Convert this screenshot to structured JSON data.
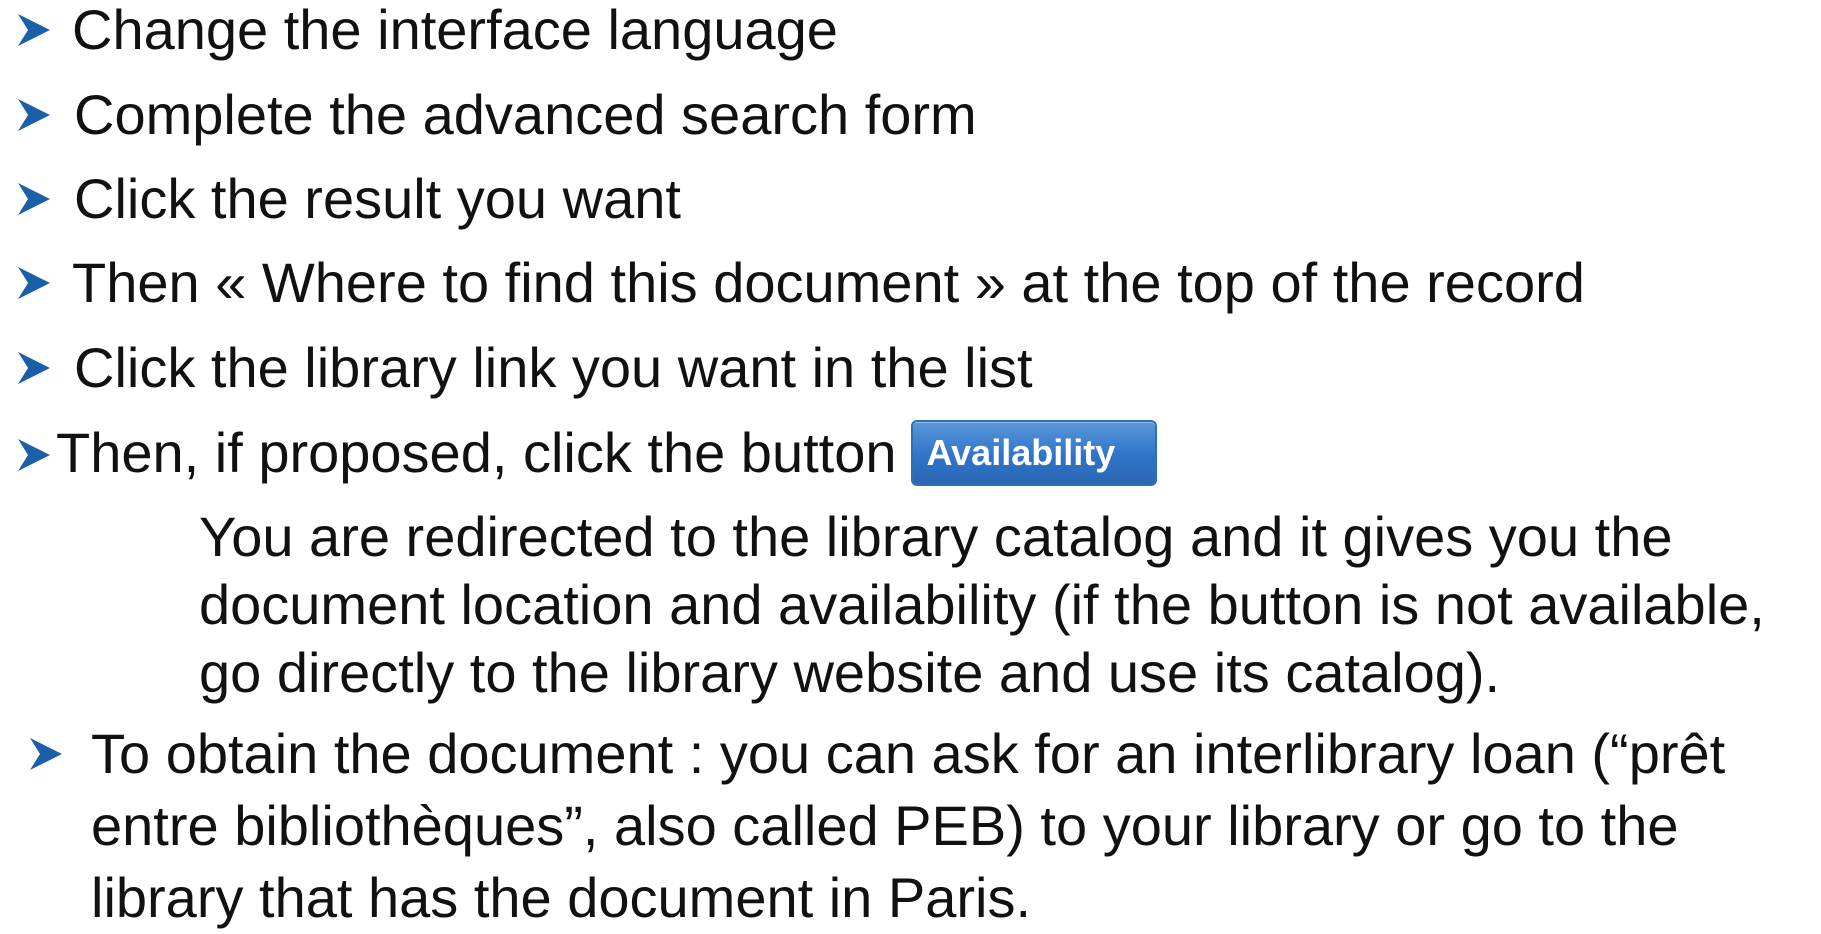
{
  "bullets": [
    {
      "text": "Change the interface language",
      "icon": "arrow-bullet-icon"
    },
    {
      "text": "Complete the advanced search form",
      "icon": "arrow-bullet-icon"
    },
    {
      "text": "Click the result you want",
      "icon": "arrow-bullet-icon"
    },
    {
      "text": "Then « Where to find this document » at the top of the record",
      "icon": "arrow-bullet-icon"
    },
    {
      "text": "Click the library link you want in the list",
      "icon": "arrow-bullet-icon"
    },
    {
      "text": "Then, if proposed, click the button",
      "icon": "arrow-bullet-icon"
    }
  ],
  "availability_button": {
    "label": "Availability"
  },
  "note_lines": [
    "You are redirected to the library catalog and it gives you the",
    "document location and availability (if the button is not available,",
    "go directly to the library website and use its catalog)."
  ],
  "last_bullet": {
    "icon": "arrow-bullet-icon",
    "lines": [
      "To obtain the document : you can ask for an interlibrary loan (“prêt",
      "entre bibliothèques”, also called PEB) to your library or go to the",
      "library that has the document in Paris."
    ]
  },
  "colors": {
    "bullet": "#1a5fa8",
    "button": "#2f74c8",
    "text": "#111111"
  }
}
